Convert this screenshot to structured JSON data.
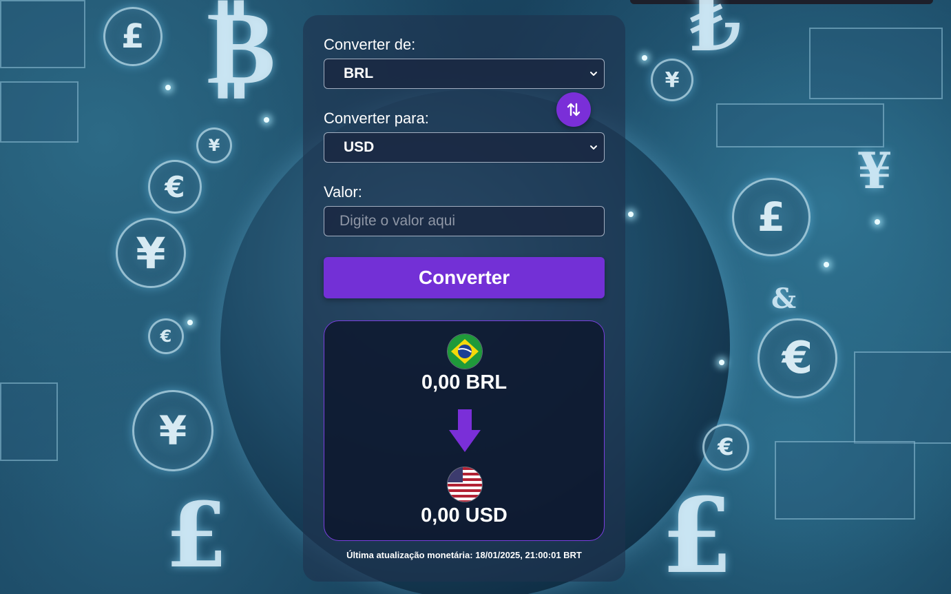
{
  "form": {
    "from_label": "Converter de:",
    "from_value": "BRL",
    "to_label": "Converter para:",
    "to_value": "USD",
    "amount_label": "Valor:",
    "amount_placeholder": "Digite o valor aqui",
    "amount_value": "",
    "convert_label": "Converter",
    "swap_icon": "swap-vertical-arrows-icon"
  },
  "result": {
    "from_flag": "brazil-flag-icon",
    "from_amount": "0,00 BRL",
    "arrow_icon": "arrow-down-icon",
    "to_flag": "usa-flag-icon",
    "to_amount": "0,00 USD"
  },
  "footer": {
    "last_update": "Última atualização monetária: 18/01/2025, 21:00:01 BRT"
  },
  "colors": {
    "accent": "#7330d6",
    "card_bg": "#1e324e",
    "result_border": "#7a3fe0"
  }
}
